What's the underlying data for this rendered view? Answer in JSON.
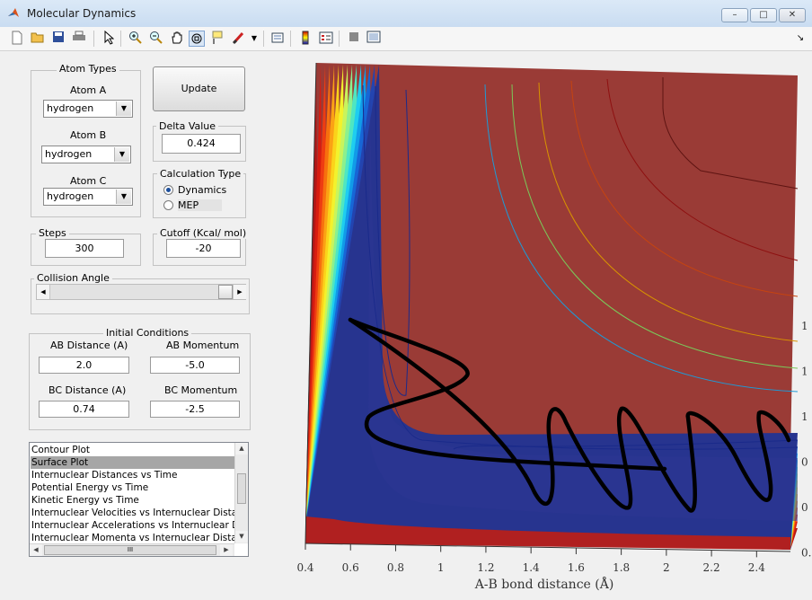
{
  "window": {
    "title": "Molecular Dynamics",
    "minimize": "–",
    "maximize": "□",
    "close": "✕"
  },
  "toolbar": {
    "icons": [
      "new-file-icon",
      "open-folder-icon",
      "save-icon",
      "print-icon",
      "pointer-icon",
      "zoom-in-icon",
      "zoom-out-icon",
      "pan-hand-icon",
      "rotate-3d-icon",
      "data-cursor-icon",
      "brush-icon",
      "dropdown-arrow-icon",
      "print-figure-icon",
      "colorbar-icon",
      "legend-icon",
      "hide-tools-icon",
      "show-tools-icon",
      "dock-arrow-icon"
    ]
  },
  "atom_types": {
    "title": "Atom Types",
    "atom_a_label": "Atom A",
    "atom_a_value": "hydrogen",
    "atom_b_label": "Atom B",
    "atom_b_value": "hydrogen",
    "atom_c_label": "Atom C",
    "atom_c_value": "hydrogen"
  },
  "update_label": "Update",
  "delta": {
    "title": "Delta Value",
    "value": "0.424"
  },
  "calc_type": {
    "title": "Calculation Type",
    "options": [
      "Dynamics",
      "MEP"
    ],
    "selected": "Dynamics"
  },
  "steps": {
    "title": "Steps",
    "value": "300"
  },
  "cutoff": {
    "title": "Cutoff (Kcal/ mol)",
    "value": "-20"
  },
  "collision": {
    "title": "Collision Angle",
    "left": "◀",
    "right": "▶"
  },
  "initial": {
    "title": "Initial Conditions",
    "ab_distance_label": "AB Distance (A)",
    "ab_distance": "2.0",
    "ab_momentum_label": "AB Momentum",
    "ab_momentum": "-5.0",
    "bc_distance_label": "BC Distance (A)",
    "bc_distance": "0.74",
    "bc_momentum_label": "BC Momentum",
    "bc_momentum": "-2.5"
  },
  "plot_list": {
    "items": [
      "Contour Plot",
      "Surface Plot",
      "Internuclear Distances vs Time",
      "Potential Energy vs Time",
      "Kinetic Energy vs Time",
      "Internuclear Velocities vs Internuclear Distance",
      "Internuclear Accelerations vs Internuclear Distance",
      "Internuclear Momenta vs Internuclear Distance"
    ],
    "selected": "Surface Plot",
    "hscroll_grip": "III"
  },
  "chart_data": {
    "type": "heatmap",
    "xlabel": "A-B bond distance (Å)",
    "xticks": [
      "0.4",
      "0.6",
      "0.8",
      "1",
      "1.2",
      "1.4",
      "1.6",
      "1.8",
      "2",
      "2.2",
      "2.4"
    ],
    "right_ticks": [
      "1",
      "1",
      "1",
      "0",
      "0",
      "0."
    ],
    "xlim": [
      0.4,
      2.55
    ],
    "ylim": [
      0.4,
      2.55
    ],
    "colormap": "jet",
    "trajectory_color": "#000000"
  }
}
